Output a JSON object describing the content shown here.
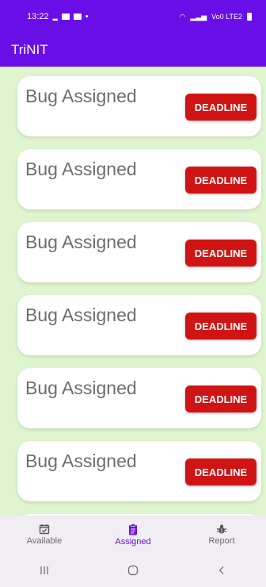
{
  "status_bar": {
    "time": "13:22",
    "left_glyph": "•",
    "right_text": "Vo0 LTE2"
  },
  "app_bar": {
    "title": "TriNIT"
  },
  "cards": [
    {
      "title": "Bug Assigned",
      "button": "DEADLINE"
    },
    {
      "title": "Bug Assigned",
      "button": "DEADLINE"
    },
    {
      "title": "Bug Assigned",
      "button": "DEADLINE"
    },
    {
      "title": "Bug Assigned",
      "button": "DEADLINE"
    },
    {
      "title": "Bug Assigned",
      "button": "DEADLINE"
    },
    {
      "title": "Bug Assigned",
      "button": "DEADLINE"
    },
    {
      "title": "",
      "button": ""
    }
  ],
  "bottom_nav": {
    "items": [
      {
        "label": "Available",
        "icon": "calendar-check-icon"
      },
      {
        "label": "Assigned",
        "icon": "clipboard-icon",
        "active": true
      },
      {
        "label": "Report",
        "icon": "bug-icon"
      }
    ]
  },
  "colors": {
    "primary": "#6a0ee8",
    "background": "#dff5cf",
    "deadline_button": "#d01414"
  }
}
